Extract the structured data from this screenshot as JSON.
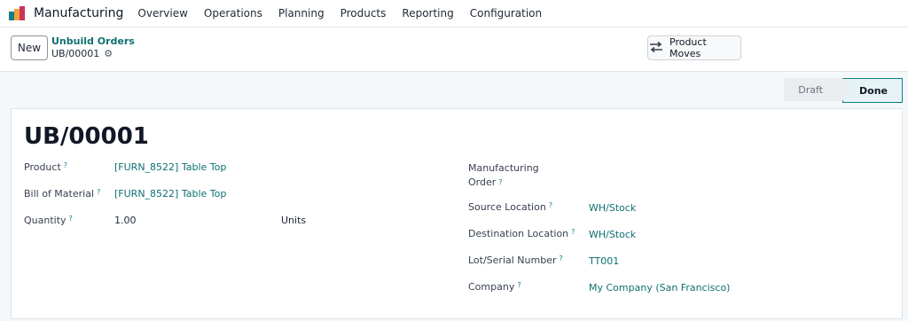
{
  "navbar": {
    "app_title": "Manufacturing",
    "menu": [
      "Overview",
      "Operations",
      "Planning",
      "Products",
      "Reporting",
      "Configuration"
    ]
  },
  "control": {
    "new_label": "New",
    "breadcrumb_parent": "Unbuild Orders",
    "breadcrumb_current": "UB/00001",
    "product_moves_label": "Product Moves"
  },
  "status": {
    "stages": [
      "Draft",
      "Done"
    ],
    "active": "Done"
  },
  "form": {
    "title": "UB/00001",
    "left": {
      "product_label": "Product",
      "product_value": "[FURN_8522] Table Top",
      "bom_label": "Bill of Material",
      "bom_value": "[FURN_8522] Table Top",
      "quantity_label": "Quantity",
      "quantity_value": "1.00",
      "uom_value": "Units"
    },
    "right": {
      "mo_label_line1": "Manufacturing",
      "mo_label_line2": "Order",
      "source_label": "Source Location",
      "source_value": "WH/Stock",
      "dest_label": "Destination Location",
      "dest_value": "WH/Stock",
      "lot_label": "Lot/Serial Number",
      "lot_value": "TT001",
      "company_label": "Company",
      "company_value": "My Company (San Francisco)"
    },
    "help_marker": "?"
  },
  "colors": {
    "accent": "#0f6f73",
    "brand_teal": "#0f7f86"
  },
  "icons": {
    "app": "manufacturing-app-icon",
    "gear": "gear-icon",
    "moves": "arrows-exchange-icon"
  }
}
